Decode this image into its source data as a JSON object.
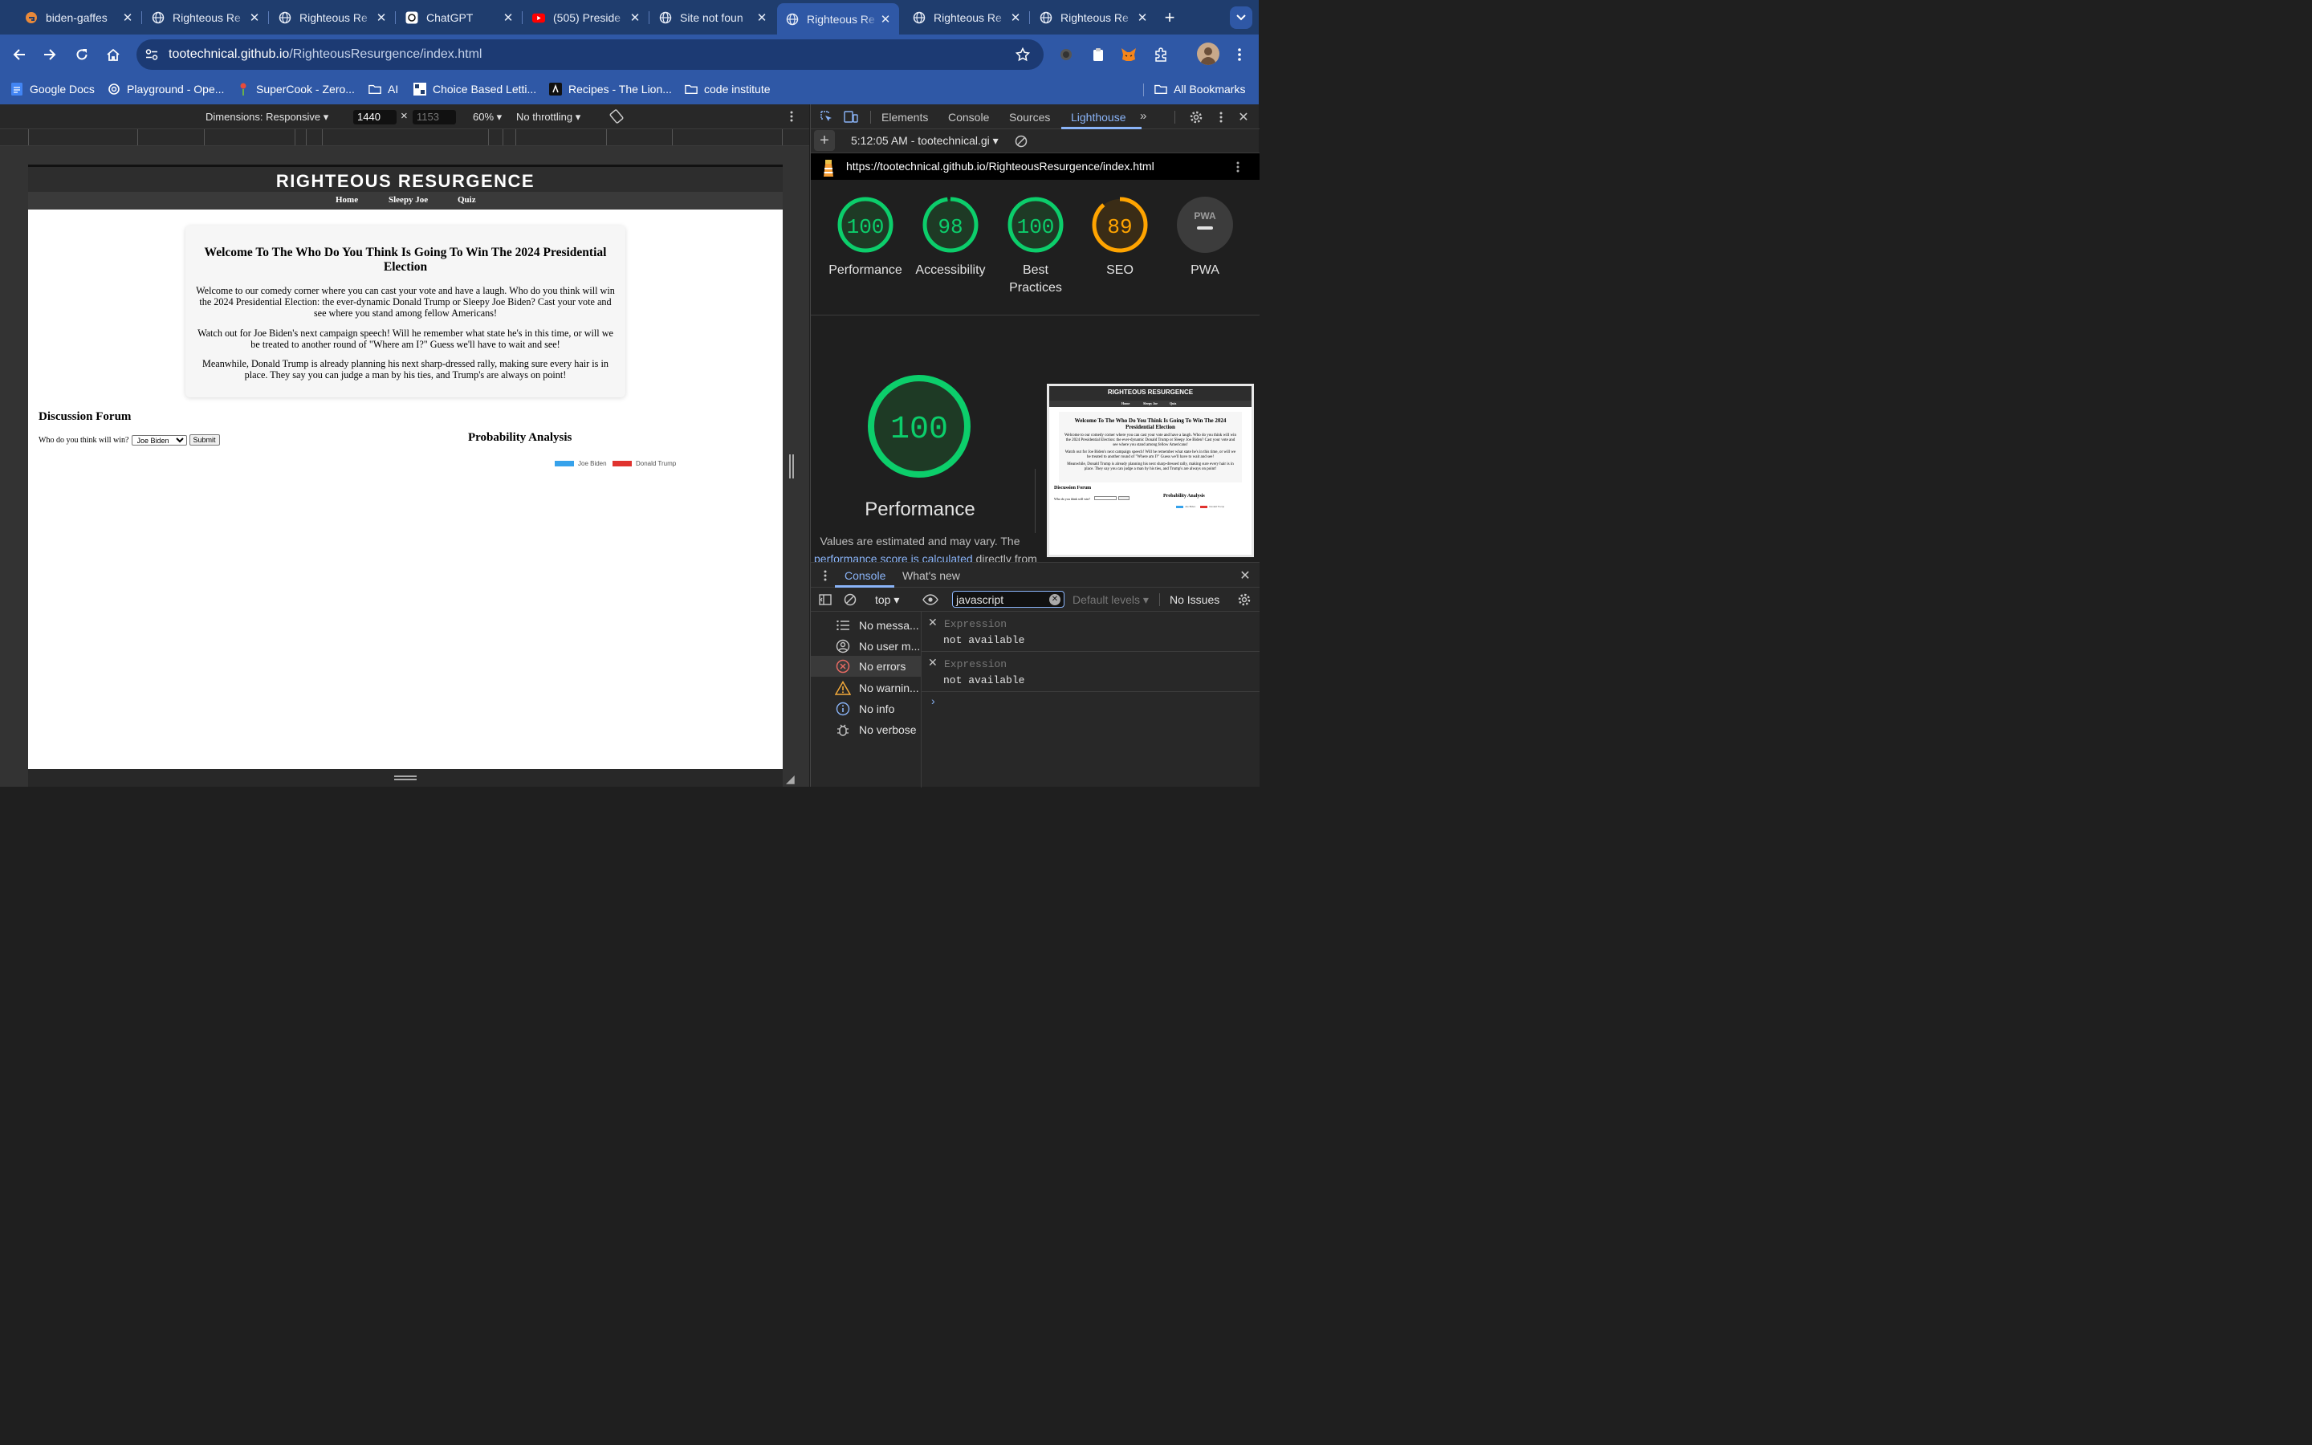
{
  "tabs": [
    {
      "title": "biden-gaffes",
      "icon": "gitlab-icon"
    },
    {
      "title": "Righteous Re",
      "icon": "globe-icon"
    },
    {
      "title": "Righteous Re",
      "icon": "globe-icon"
    },
    {
      "title": "ChatGPT",
      "icon": "openai-icon"
    },
    {
      "title": "(505) Preside",
      "icon": "youtube-icon"
    },
    {
      "title": "Site not foun",
      "icon": "globe-icon"
    },
    {
      "title": "Righteous Re",
      "icon": "globe-icon",
      "active": true
    },
    {
      "title": "Righteous Re",
      "icon": "globe-icon"
    },
    {
      "title": "Righteous Re",
      "icon": "globe-icon"
    }
  ],
  "address": {
    "host": "tootechnical.github.io",
    "path": "/RighteousResurgence/index.html"
  },
  "bookmarks": [
    "Google Docs",
    "Playground - Ope...",
    "SuperCook - Zero...",
    "AI",
    "Choice Based Letti...",
    "Recipes - The Lion...",
    "code institute"
  ],
  "all_bookmarks": "All Bookmarks",
  "device": {
    "dimensions": "Dimensions: Responsive",
    "width": "1440",
    "height": "1153",
    "zoom": "60%",
    "throttling": "No throttling"
  },
  "site": {
    "brand": "RIGHTEOUS RESURGENCE",
    "nav": [
      "Home",
      "Sleepy Joe",
      "Quiz"
    ],
    "welcome_title": "Welcome To The Who Do You Think Is Going To Win The 2024 Presidential Election",
    "paragraphs": [
      "Welcome to our comedy corner where you can cast your vote and have a laugh. Who do you think will win the 2024 Presidential Election: the ever-dynamic Donald Trump or Sleepy Joe Biden? Cast your vote and see where you stand among fellow Americans!",
      "Watch out for Joe Biden's next campaign speech! Will he remember what state he's in this time, or will we be treated to another round of \"Where am I?\" Guess we'll have to wait and see!",
      "Meanwhile, Donald Trump is already planning his next sharp-dressed rally, making sure every hair is in place. They say you can judge a man by his ties, and Trump's are always on point!"
    ],
    "forum_title": "Discussion Forum",
    "forum_question": "Who do you think will win?",
    "forum_select": "Joe Biden",
    "forum_submit": "Submit",
    "prob_title": "Probability Analysis",
    "legend": [
      {
        "name": "Joe Biden",
        "color": "#36a2eb"
      },
      {
        "name": "Donald Trump",
        "color": "#e0332f"
      }
    ]
  },
  "devtools": {
    "tabs": [
      "Elements",
      "Console",
      "Sources",
      "Lighthouse"
    ],
    "report_time": "5:12:05 AM - tootechnical.gi",
    "report_url": "https://tootechnical.github.io/RighteousResurgence/index.html",
    "scores": [
      {
        "label": "Performance",
        "value": "100",
        "color": "#0cce6b"
      },
      {
        "label": "Accessibility",
        "value": "98",
        "color": "#0cce6b"
      },
      {
        "label": "Best Practices",
        "value": "100",
        "color": "#0cce6b"
      },
      {
        "label": "SEO",
        "value": "89",
        "color": "#ffa400"
      },
      {
        "label": "PWA",
        "value": "PWA",
        "color": "#9e9e9e"
      }
    ],
    "big_score": "100",
    "big_label": "Performance",
    "note": "Values are estimated and may vary. The",
    "note_link": "performance score is calculated",
    "note_tail": " directly from",
    "thumb_brand": "RIGHTEOUS RESURGENCE",
    "thumb_nav": [
      "Home",
      "Sleepy Joe",
      "Quiz"
    ],
    "thumb_legend": [
      "Joe Biden",
      "Donald Trump"
    ]
  },
  "console": {
    "tabs": [
      "Console",
      "What's new"
    ],
    "context": "top",
    "filter": "javascript",
    "levels": "Default levels",
    "issues": "No Issues",
    "sidebar": [
      "No messa...",
      "No user m...",
      "No errors",
      "No warnin...",
      "No info",
      "No verbose"
    ],
    "expression_label": "Expression",
    "expression_value": "not available"
  }
}
